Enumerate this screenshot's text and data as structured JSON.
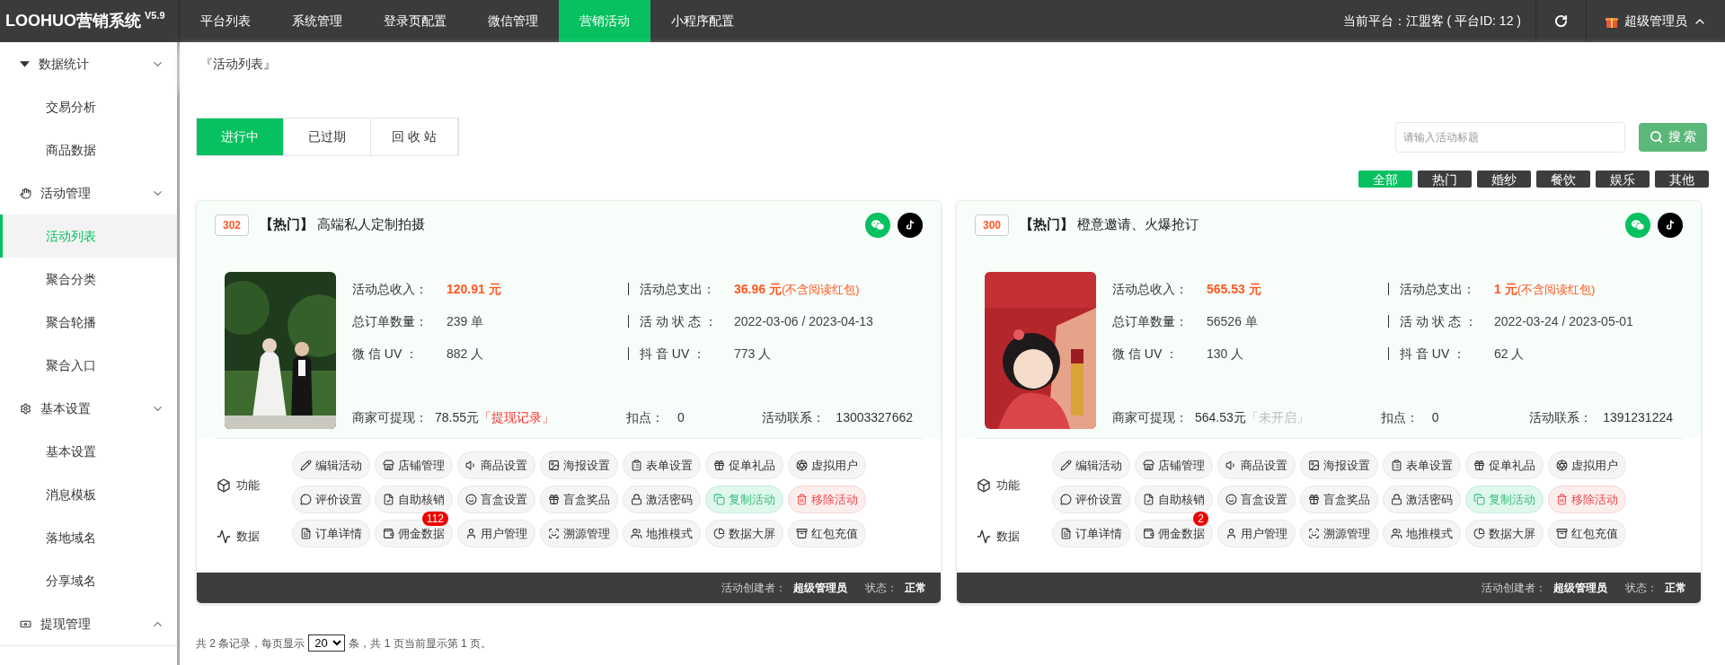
{
  "header": {
    "logo": "LOOHUO营销系统",
    "version": "V5.9",
    "nav": [
      {
        "label": "平台列表",
        "selected": false
      },
      {
        "label": "系统管理",
        "selected": false
      },
      {
        "label": "登录页配置",
        "selected": false
      },
      {
        "label": "微信管理",
        "selected": false
      },
      {
        "label": "营销活动",
        "selected": true
      },
      {
        "label": "小程序配置",
        "selected": false
      }
    ],
    "platform": "当前平台：江盟客 ( 平台ID: 12 )",
    "user": "超级管理员"
  },
  "sidebar": {
    "groups": [
      {
        "label": "数据统计",
        "expanded": true,
        "children": [
          {
            "label": "交易分析",
            "selected": false
          },
          {
            "label": "商品数据",
            "selected": false
          }
        ]
      },
      {
        "label": "活动管理",
        "expanded": true,
        "children": [
          {
            "label": "活动列表",
            "selected": true
          },
          {
            "label": "聚合分类",
            "selected": false
          },
          {
            "label": "聚合轮播",
            "selected": false
          },
          {
            "label": "聚合入口",
            "selected": false
          }
        ]
      },
      {
        "label": "基本设置",
        "expanded": true,
        "children": [
          {
            "label": "基本设置",
            "selected": false
          },
          {
            "label": "消息模板",
            "selected": false
          },
          {
            "label": "落地域名",
            "selected": false
          },
          {
            "label": "分享域名",
            "selected": false
          }
        ]
      },
      {
        "label": "提现管理",
        "expanded": false
      }
    ]
  },
  "breadcrumb": "『活动列表』",
  "tabs": [
    {
      "label": "进行中",
      "selected": true
    },
    {
      "label": "已过期",
      "selected": false
    },
    {
      "label": "回 收 站",
      "selected": false
    }
  ],
  "search": {
    "placeholder": "请输入活动标题",
    "button": "搜 索"
  },
  "categories": [
    {
      "label": "全部",
      "selected": true
    },
    {
      "label": "热门",
      "selected": false
    },
    {
      "label": "婚纱",
      "selected": false
    },
    {
      "label": "餐饮",
      "selected": false
    },
    {
      "label": "娱乐",
      "selected": false
    },
    {
      "label": "其他",
      "selected": false
    }
  ],
  "cards": [
    {
      "id": "302",
      "tag": "【热门】",
      "title": "高端私人定制拍摄",
      "stats": [
        {
          "label": "活动总收入：",
          "value": "120.91 元",
          "kind": "money"
        },
        {
          "label": "活动总支出：",
          "value": "36.96 元",
          "note": "(不含阅读红包)",
          "kind": "money"
        },
        {
          "label": "总订单数量：",
          "value": "239 单",
          "kind": "plain"
        },
        {
          "label": "活 动 状 态 ：",
          "value": "2022-03-06 / 2023-04-13",
          "kind": "plain"
        },
        {
          "label": "微 信 UV ：",
          "value": "882 人",
          "kind": "plain"
        },
        {
          "label": "抖 音 UV ：",
          "value": "773 人",
          "kind": "plain"
        }
      ],
      "withdraw_label": "商家可提现：",
      "withdraw": "78.55元",
      "withdraw_link": {
        "text": "「提现记录」",
        "enabled": true
      },
      "deduct_label": "扣点：",
      "deduct": "0",
      "contact_label": "活动联系：",
      "contact": "13003327662",
      "section_labels": [
        "功能",
        "数据"
      ],
      "buttons": [
        {
          "label": "编辑活动",
          "kind": "normal"
        },
        {
          "label": "店铺管理",
          "kind": "normal"
        },
        {
          "label": "商品设置",
          "kind": "normal"
        },
        {
          "label": "海报设置",
          "kind": "normal"
        },
        {
          "label": "表单设置",
          "kind": "normal"
        },
        {
          "label": "促单礼品",
          "kind": "normal"
        },
        {
          "label": "虚拟用户",
          "kind": "normal"
        },
        {
          "label": "评价设置",
          "kind": "normal"
        },
        {
          "label": "自助核销",
          "kind": "normal"
        },
        {
          "label": "盲盒设置",
          "kind": "normal"
        },
        {
          "label": "盲盒奖品",
          "kind": "normal"
        },
        {
          "label": "激活密码",
          "kind": "normal"
        },
        {
          "label": "复制活动",
          "kind": "copy"
        },
        {
          "label": "移除活动",
          "kind": "remove"
        },
        {
          "label": "订单详情",
          "kind": "normal"
        },
        {
          "label": "佣金数据",
          "kind": "normal",
          "badge": "112"
        },
        {
          "label": "用户管理",
          "kind": "normal"
        },
        {
          "label": "溯源管理",
          "kind": "normal"
        },
        {
          "label": "地推模式",
          "kind": "normal"
        },
        {
          "label": "数据大屏",
          "kind": "normal"
        },
        {
          "label": "红包充值",
          "kind": "normal"
        }
      ],
      "creator_label": "活动创建者：",
      "creator": "超级管理员",
      "status_label": "状态：",
      "status": "正常"
    },
    {
      "id": "300",
      "tag": "【热门】",
      "title": "橙意邀请、火爆抢订",
      "stats": [
        {
          "label": "活动总收入：",
          "value": "565.53 元",
          "kind": "money"
        },
        {
          "label": "活动总支出：",
          "value": "1 元",
          "note": "(不含阅读红包)",
          "kind": "money"
        },
        {
          "label": "总订单数量：",
          "value": "56526 单",
          "kind": "plain"
        },
        {
          "label": "活 动 状 态 ：",
          "value": "2022-03-24 / 2023-05-01",
          "kind": "plain"
        },
        {
          "label": "微 信 UV ：",
          "value": "130 人",
          "kind": "plain"
        },
        {
          "label": "抖 音 UV ：",
          "value": "62 人",
          "kind": "plain"
        }
      ],
      "withdraw_label": "商家可提现：",
      "withdraw": "564.53元",
      "withdraw_link": {
        "text": "「未开启」",
        "enabled": false
      },
      "deduct_label": "扣点：",
      "deduct": "0",
      "contact_label": "活动联系：",
      "contact": "1391231224",
      "section_labels": [
        "功能",
        "数据"
      ],
      "buttons": [
        {
          "label": "编辑活动",
          "kind": "normal"
        },
        {
          "label": "店铺管理",
          "kind": "normal"
        },
        {
          "label": "商品设置",
          "kind": "normal"
        },
        {
          "label": "海报设置",
          "kind": "normal"
        },
        {
          "label": "表单设置",
          "kind": "normal"
        },
        {
          "label": "促单礼品",
          "kind": "normal"
        },
        {
          "label": "虚拟用户",
          "kind": "normal"
        },
        {
          "label": "评价设置",
          "kind": "normal"
        },
        {
          "label": "自助核销",
          "kind": "normal"
        },
        {
          "label": "盲盒设置",
          "kind": "normal"
        },
        {
          "label": "盲盒奖品",
          "kind": "normal"
        },
        {
          "label": "激活密码",
          "kind": "normal"
        },
        {
          "label": "复制活动",
          "kind": "copy"
        },
        {
          "label": "移除活动",
          "kind": "remove"
        },
        {
          "label": "订单详情",
          "kind": "normal"
        },
        {
          "label": "佣金数据",
          "kind": "normal",
          "badge": "2"
        },
        {
          "label": "用户管理",
          "kind": "normal"
        },
        {
          "label": "溯源管理",
          "kind": "normal"
        },
        {
          "label": "地推模式",
          "kind": "normal"
        },
        {
          "label": "数据大屏",
          "kind": "normal"
        },
        {
          "label": "红包充值",
          "kind": "normal"
        }
      ],
      "creator_label": "活动创建者：",
      "creator": "超级管理员",
      "status_label": "状态：",
      "status": "正常"
    }
  ],
  "pagination": {
    "prefix": "共 2 条记录，每页显示",
    "page_size": "20",
    "suffix": "条，共 1 页当前显示第 1 页。"
  }
}
